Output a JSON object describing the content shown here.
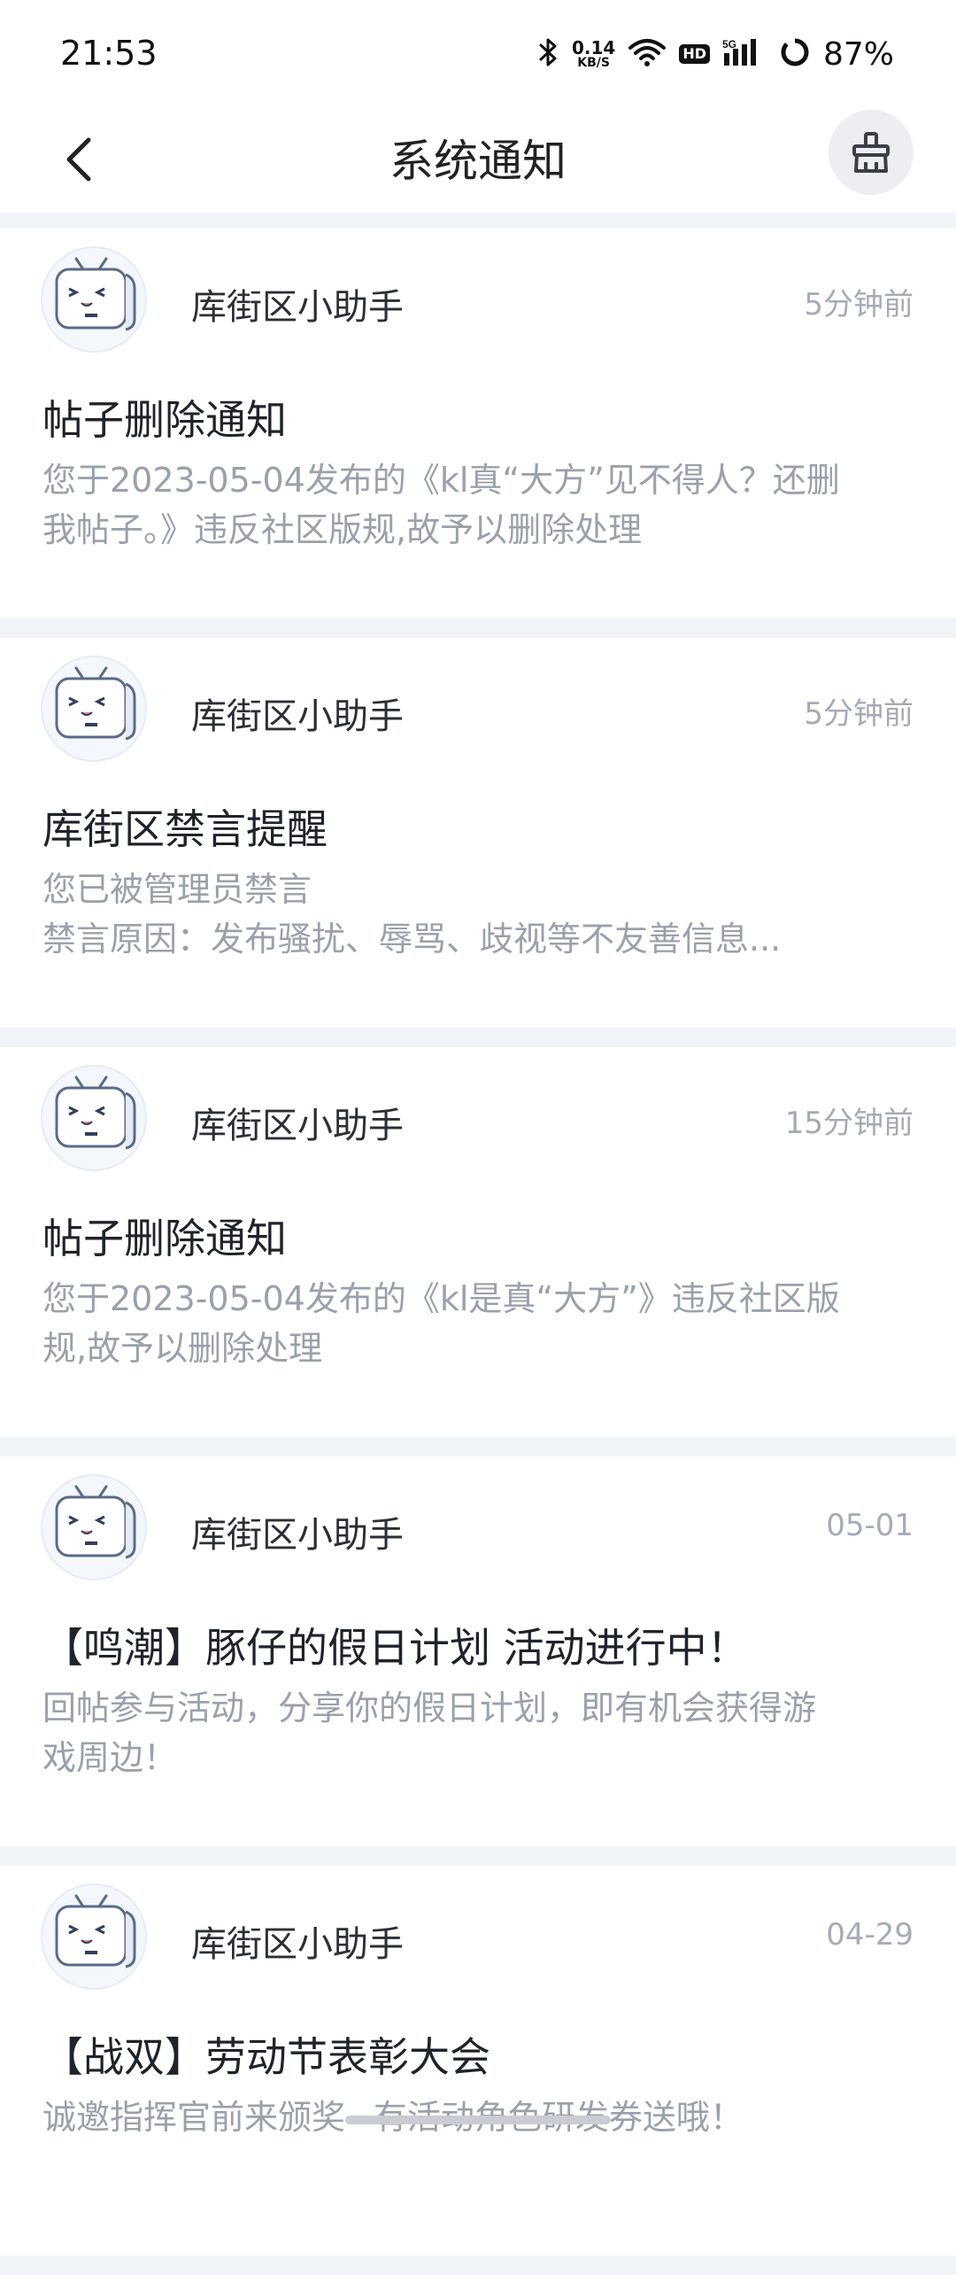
{
  "status_bar": {
    "time": "21:53",
    "net_speed_value": "0.14",
    "net_speed_unit": "KB/S",
    "hd": "HD",
    "network": "5G",
    "battery": "87%"
  },
  "header": {
    "title": "系统通知"
  },
  "notifications": [
    {
      "sender": "库街区小助手",
      "time": "5分钟前",
      "title": "帖子删除通知",
      "body_lines": [
        "您于2023-05-04发布的《kl真“大方”见不得人？还删",
        "我帖子。》违反社区版规,故予以删除处理"
      ]
    },
    {
      "sender": "库街区小助手",
      "time": "5分钟前",
      "title": "库街区禁言提醒",
      "body_lines": [
        "您已被管理员禁言",
        "禁言原因：发布骚扰、辱骂、歧视等不友善信息..."
      ]
    },
    {
      "sender": "库街区小助手",
      "time": "15分钟前",
      "title": "帖子删除通知",
      "body_lines": [
        "您于2023-05-04发布的《kl是真“大方”》违反社区版",
        "规,故予以删除处理"
      ]
    },
    {
      "sender": "库街区小助手",
      "time": "05-01",
      "title": "【鸣潮】豚仔的假日计划 活动进行中！",
      "body_lines": [
        "回帖参与活动，分享你的假日计划，即有机会获得游",
        "戏周边！"
      ]
    },
    {
      "sender": "库街区小助手",
      "time": "04-29",
      "title": "【战双】劳动节表彰大会",
      "body_lines": [
        "诚邀指挥官前来颁奖~有活动角色研发券送哦！",
        ""
      ]
    }
  ]
}
